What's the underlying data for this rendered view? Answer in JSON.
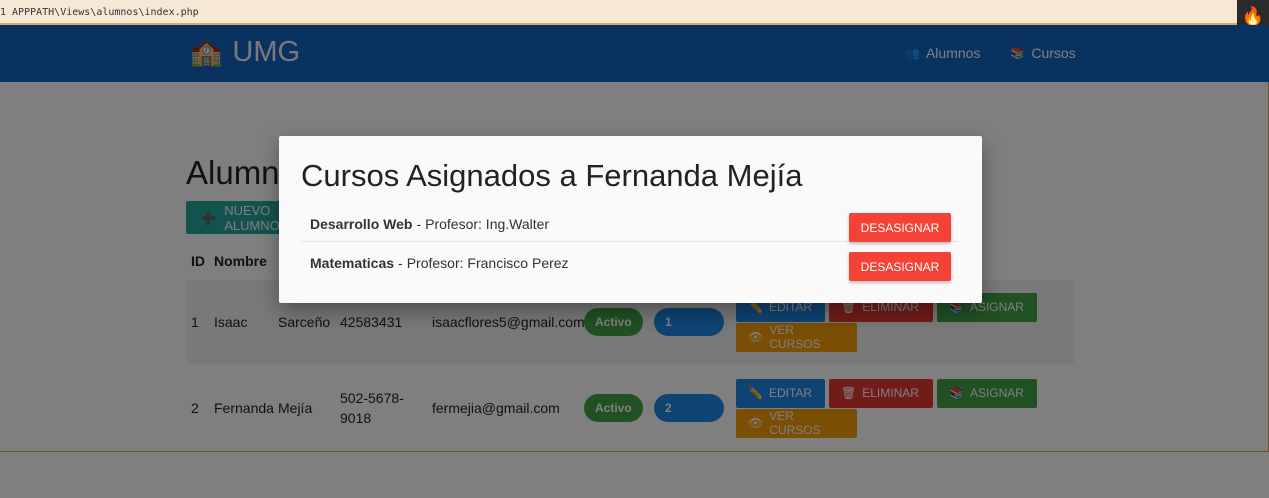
{
  "debugbar": {
    "path": "1 APPPATH\\Views\\alumnos\\index.php",
    "icon": "flame-icon"
  },
  "navbar": {
    "brand": "UMG",
    "links": [
      {
        "label": "Alumnos",
        "icon": "students-icon"
      },
      {
        "label": "Cursos",
        "icon": "books-icon"
      }
    ]
  },
  "page": {
    "title": "Alumnos",
    "new_button": "NUEVO ALUMNO",
    "headers": {
      "id": "ID",
      "nombre": "Nombre"
    },
    "rows": [
      {
        "id": "1",
        "nombre": "Isaac",
        "apellido": "Sarceño",
        "telefono": "42583431",
        "email": "isaacflores5@gmail.com",
        "estado": "Activo",
        "cursos": "1"
      },
      {
        "id": "2",
        "nombre": "Fernanda",
        "apellido": "Mejía",
        "telefono": "502-5678-9018",
        "email": "fermejia@gmail.com",
        "estado": "Activo",
        "cursos": "2"
      }
    ],
    "actions": {
      "editar": "EDITAR",
      "eliminar": "ELIMINAR",
      "asignar": "ASIGNAR",
      "ver_cursos": "VER CURSOS"
    }
  },
  "modal": {
    "title": "Cursos Asignados a Fernanda Mejía",
    "items": [
      {
        "curso": "Desarrollo Web",
        "profesor": "Profesor: Ing.Walter",
        "button": "DESASIGNAR"
      },
      {
        "curso": "Matematicas",
        "profesor": "Profesor: Francisco Perez",
        "button": "DESASIGNAR"
      }
    ]
  },
  "colors": {
    "navbar": "#1565c0",
    "danger": "#f44336",
    "success": "#43a047",
    "primary": "#1e88e5",
    "warning": "#f59e0b"
  }
}
